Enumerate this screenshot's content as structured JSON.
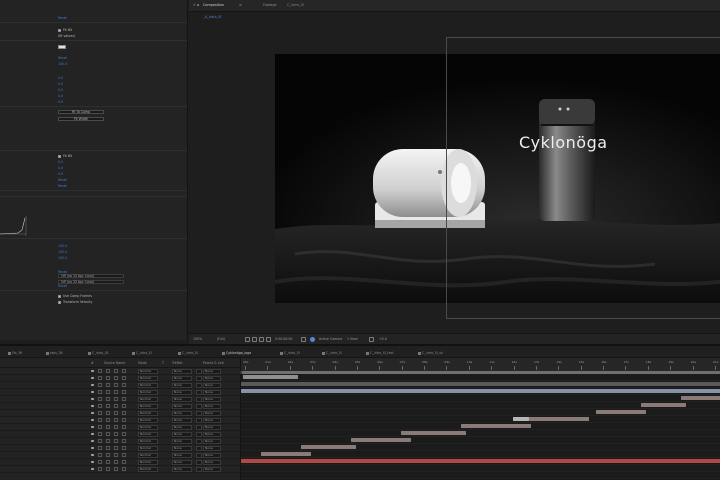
{
  "viewer": {
    "tabs": [
      "Composition",
      "Footage",
      "C_intro_SI"
    ],
    "sub_tab": "_A_intro_SI",
    "brand_text": "Cyklonöga",
    "toolbar": {
      "zoom": "100%",
      "resolution": "(Full)",
      "timecode": "0:00:00:00",
      "camera": "Active Camera",
      "views": "1 View",
      "exposure": "+0.0"
    }
  },
  "effect_controls": {
    "rows": [
      {
        "text": "Reset",
        "color": "blue"
      },
      {
        "text": "Fit Bit",
        "color": "white",
        "check": true
      },
      {
        "text": "(fit values)",
        "color": "white"
      },
      {
        "text": "Reset",
        "color": "blue"
      },
      {
        "text": "100.0",
        "color": "blue"
      },
      {
        "text": "0.0",
        "color": "blue"
      },
      {
        "text": "0.0",
        "color": "blue"
      },
      {
        "text": "0.0",
        "color": "blue"
      },
      {
        "text": "0.0",
        "color": "blue"
      },
      {
        "text": "0.0",
        "color": "blue"
      },
      {
        "text": "Fit Bit",
        "color": "white",
        "check": true
      },
      {
        "text": "0.0",
        "color": "blue"
      },
      {
        "text": "0.0",
        "color": "blue"
      },
      {
        "text": "0.0",
        "color": "blue"
      },
      {
        "text": "Reset",
        "color": "blue"
      },
      {
        "text": "Reset",
        "color": "blue"
      },
      {
        "text": "100.0",
        "color": "blue"
      },
      {
        "text": "100.0",
        "color": "blue"
      },
      {
        "text": "100.0",
        "color": "blue"
      },
      {
        "text": "Reset",
        "color": "blue"
      },
      {
        "text": "Reset",
        "color": "blue"
      }
    ],
    "boxes": [
      "Fit To Comp",
      "Fit Width"
    ],
    "dropdowns": [
      "Off (no 32 bpc Color)",
      "Off (no 32 bpc Color)"
    ],
    "checkboxes": [
      "Use Comp Frames",
      "Transform Velocity"
    ]
  },
  "timeline": {
    "tabs": [
      "Ob_36",
      "tabs_36",
      "C_intro_01",
      "C_intro_SI",
      "C_intro_SI",
      "Cyklonöga_logo",
      "C_intro_SI",
      "C_intro_SI",
      "C_intro_SI_text",
      "C_intro_SI_sk"
    ],
    "active_tab_index": 5,
    "column_headers": [
      "#",
      "Source Name",
      "Mode",
      "T",
      "TrkMat",
      "Parent & Link"
    ],
    "layers": [
      {
        "mode": "Normal",
        "trkmat": "None",
        "parent": "None"
      },
      {
        "mode": "Normal",
        "trkmat": "None",
        "parent": "None"
      },
      {
        "mode": "Normal",
        "trkmat": "None",
        "parent": "None"
      },
      {
        "mode": "Normal",
        "trkmat": "None",
        "parent": "None"
      },
      {
        "mode": "Normal",
        "trkmat": "None",
        "parent": "None"
      },
      {
        "mode": "Normal",
        "trkmat": "None",
        "parent": "None"
      },
      {
        "mode": "Normal",
        "trkmat": "None",
        "parent": "None"
      },
      {
        "mode": "Normal",
        "trkmat": "None",
        "parent": "None"
      },
      {
        "mode": "Normal",
        "trkmat": "None",
        "parent": "None"
      },
      {
        "mode": "Normal",
        "trkmat": "None",
        "parent": "None"
      },
      {
        "mode": "Normal",
        "trkmat": "None",
        "parent": "None"
      },
      {
        "mode": "Normal",
        "trkmat": "None",
        "parent": "None"
      },
      {
        "mode": "Normal",
        "trkmat": "None",
        "parent": "None"
      },
      {
        "mode": "Normal",
        "trkmat": "None",
        "parent": "None"
      },
      {
        "mode": "Normal",
        "trkmat": "None",
        "parent": "None"
      }
    ],
    "ruler_labels": [
      "00s",
      "01s",
      "02s",
      "03s",
      "04s",
      "05s",
      "06s",
      "07s",
      "08s",
      "09s",
      "10s",
      "11s",
      "12s",
      "13s",
      "14s",
      "15s",
      "16s",
      "17s",
      "18s",
      "19s",
      "20s",
      "21s"
    ],
    "colors": {
      "layer_bar": "#8a7a78",
      "grey_bar": "#8f8f8f",
      "blue_bar": "#8592a8",
      "red_bar": "#b04848"
    }
  }
}
